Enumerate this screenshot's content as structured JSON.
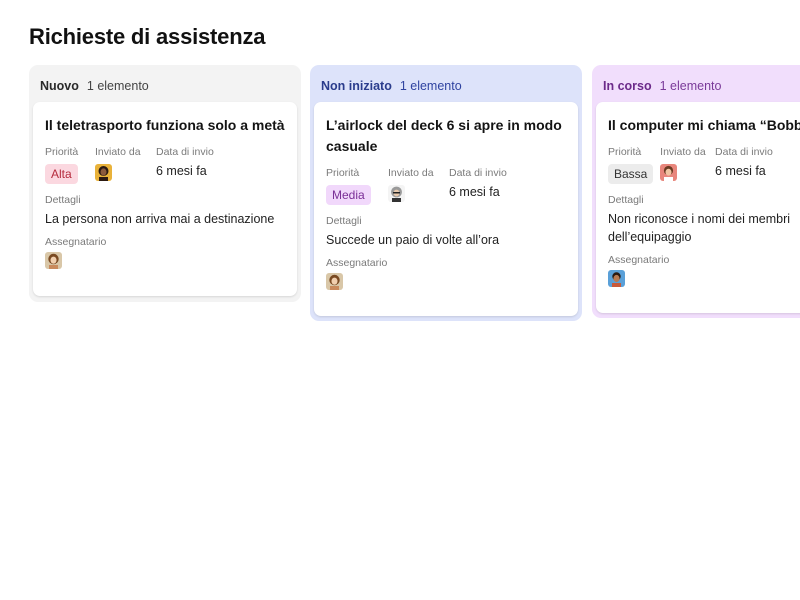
{
  "page": {
    "title": "Richieste di assistenza"
  },
  "labels": {
    "priority": "Priorità",
    "sent_by": "Inviato da",
    "sent_date": "Data di invio",
    "details": "Dettagli",
    "assignee": "Assegnatario"
  },
  "columns": [
    {
      "name": "Nuovo",
      "count": "1 elemento",
      "card": {
        "title": "Il teletrasporto funziona solo a metà",
        "priority": "Alta",
        "date": "6 mesi fa",
        "details": "La persona non arriva mai a destinazione"
      }
    },
    {
      "name": "Non iniziato",
      "count": "1 elemento",
      "card": {
        "title": "L’airlock del deck 6 si apre in modo casuale",
        "priority": "Media",
        "date": "6 mesi fa",
        "details": "Succede un paio di volte all’ora"
      }
    },
    {
      "name": "In corso",
      "count": "1 elemento",
      "card": {
        "title": "Il computer mi chiama “Bobby",
        "priority": "Bassa",
        "date": "6 mesi fa",
        "details": "Non riconosce i nomi dei membri dell’equipaggio"
      }
    }
  ],
  "colors": {
    "column_new_bg": "#f3f3f3",
    "column_not_started_bg": "#dde3fa",
    "column_in_progress_bg": "#f1defc",
    "priority_high": "#b52b3d",
    "priority_medium": "#7a2e96",
    "priority_low": "#333333"
  }
}
